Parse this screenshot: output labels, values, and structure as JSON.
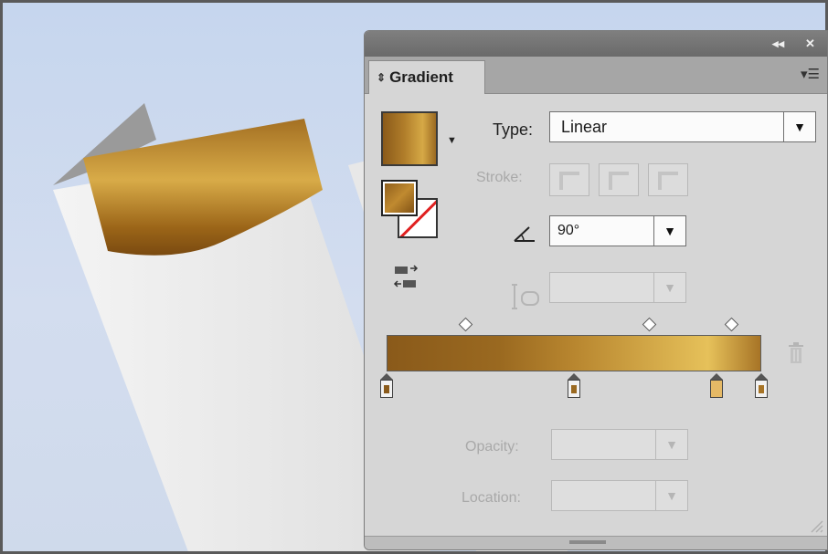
{
  "panel": {
    "tab_label": "Gradient",
    "title_buttons": {
      "collapse": "◂◂",
      "close": "✕"
    },
    "panel_menu_icon": "panel-menu-icon"
  },
  "gradient": {
    "type_label": "Type:",
    "type_value": "Linear",
    "stroke_label": "Stroke:",
    "angle_value": "90°",
    "opacity_label": "Opacity:",
    "location_label": "Location:",
    "midpoints": [
      0.21,
      0.7,
      0.92
    ],
    "stops": [
      {
        "position": 0.0,
        "color": "#8a5a1a",
        "selected": false
      },
      {
        "position": 0.5,
        "color": "#9a6920",
        "selected": false
      },
      {
        "position": 0.88,
        "color": "#e5b966",
        "selected": true
      },
      {
        "position": 1.0,
        "color": "#a77426",
        "selected": false
      }
    ]
  },
  "colors": {
    "accent_gold": "#c08a30",
    "panel_bg": "#d6d6d6",
    "titlebar": "#6f6f6f"
  },
  "icons": [
    "swatch-dropdown-icon",
    "angle-icon",
    "aspect-ratio-icon",
    "reverse-gradient-icon",
    "delete-stop-icon",
    "dropdown-arrow-icon"
  ]
}
